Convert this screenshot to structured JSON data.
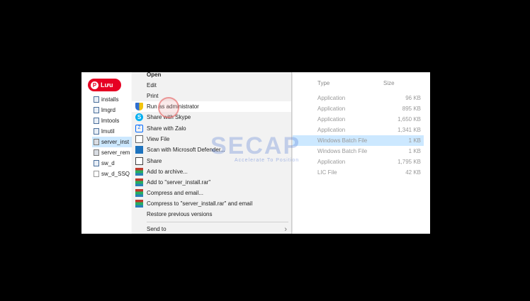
{
  "pinterest": {
    "label": "Lưu",
    "icon": "pinterest-icon"
  },
  "files": [
    {
      "name": "installs",
      "icon": "folder-icon"
    },
    {
      "name": "lmgrd",
      "icon": "app-icon"
    },
    {
      "name": "lmtools",
      "icon": "app-icon"
    },
    {
      "name": "lmutil",
      "icon": "app-icon"
    },
    {
      "name": "server_inst",
      "icon": "gear-icon",
      "selected": true
    },
    {
      "name": "server_rem",
      "icon": "gear-icon"
    },
    {
      "name": "sw_d",
      "icon": "app-icon"
    },
    {
      "name": "sw_d_SSQ",
      "icon": "doc-icon"
    }
  ],
  "context_menu": {
    "open": "Open",
    "edit": "Edit",
    "print": "Print",
    "run_as_admin": "Run as administrator",
    "share_skype": "Share with Skype",
    "share_zalo": "Share with Zalo",
    "view_file": "View File",
    "scan_defender": "Scan with Microsoft Defender...",
    "share": "Share",
    "add_archive": "Add to archive...",
    "add_rar": "Add to \"server_install.rar\"",
    "compress_email": "Compress and email...",
    "compress_rar_email": "Compress to \"server_install.rar\" and email",
    "restore_versions": "Restore previous versions",
    "send_to": "Send to"
  },
  "details": {
    "header_type": "Type",
    "header_size": "Size",
    "rows": [
      {
        "type": "Application",
        "size": "96 KB"
      },
      {
        "type": "Application",
        "size": "895 KB"
      },
      {
        "type": "Application",
        "size": "1,650 KB"
      },
      {
        "type": "Application",
        "size": "1,341 KB"
      },
      {
        "type": "Windows Batch File",
        "size": "1 KB",
        "selected": true
      },
      {
        "type": "Windows Batch File",
        "size": "1 KB"
      },
      {
        "type": "Application",
        "size": "1,795 KB"
      },
      {
        "type": "LIC File",
        "size": "42 KB"
      }
    ]
  },
  "watermark": {
    "brand": "SECAP",
    "tagline": "Accelerate To Position"
  },
  "colors": {
    "selection": "#cce8ff",
    "pinterest": "#e60023",
    "menu_bg": "#f2f2f2"
  }
}
